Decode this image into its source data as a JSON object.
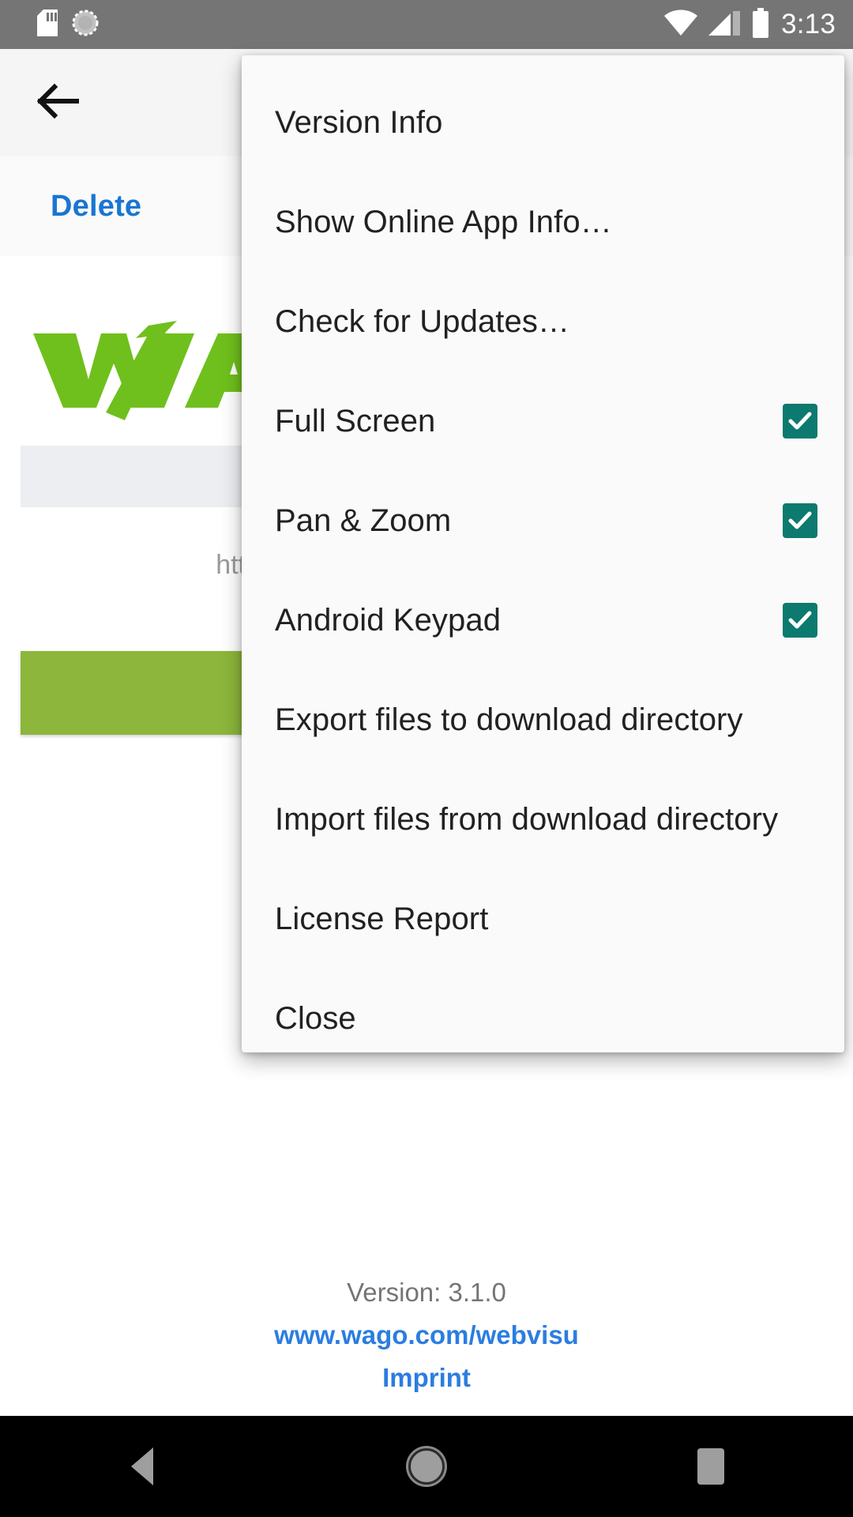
{
  "status_bar": {
    "icons": [
      "sd-card-icon",
      "sync-spinner-icon",
      "wifi-icon",
      "cellular-signal-icon",
      "battery-icon"
    ],
    "clock": "3:13",
    "background_color": "#757575",
    "foreground_color": "#ffffff"
  },
  "toolbar": {
    "back_icon": "back-arrow-icon"
  },
  "action_bar": {
    "delete_label": "Delete",
    "link_color": "#1976d2"
  },
  "content": {
    "logo_alt": "WAGO",
    "logo_color": "#6FC01C",
    "url_text": "http",
    "button_color": "#8cb63c"
  },
  "menu": {
    "items": [
      {
        "label": "Version Info",
        "type": "action"
      },
      {
        "label": "Show Online App Info…",
        "type": "action"
      },
      {
        "label": "Check for Updates…",
        "type": "action"
      },
      {
        "label": "Full Screen",
        "type": "checkbox",
        "checked": true
      },
      {
        "label": "Pan & Zoom",
        "type": "checkbox",
        "checked": true
      },
      {
        "label": "Android Keypad",
        "type": "checkbox",
        "checked": true
      },
      {
        "label": "Export files to download directory",
        "type": "action"
      },
      {
        "label": "Import files from download directory",
        "type": "action"
      },
      {
        "label": "License Report",
        "type": "action"
      },
      {
        "label": "Close",
        "type": "action"
      }
    ],
    "background_color": "#fafafa",
    "checkbox_color": "#0c7a6e",
    "text_color": "#212121"
  },
  "footer": {
    "version": "Version: 3.1.0",
    "website": "www.wago.com/webvisu",
    "imprint": "Imprint",
    "link_color": "#2b7de0",
    "version_color": "#757575"
  },
  "nav_bar": {
    "back_label": "back-nav-button",
    "home_label": "home-nav-button",
    "recents_label": "recents-nav-button",
    "background_color": "#000000"
  }
}
